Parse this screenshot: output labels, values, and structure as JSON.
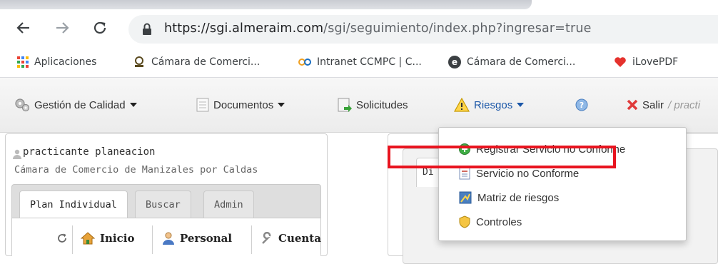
{
  "browser": {
    "url_host": "https://sgi.almeraim.com",
    "url_path": "/sgi/seguimiento/index.php?ingresar=true",
    "nav_icons": [
      "back-arrow-icon",
      "forward-arrow-icon",
      "reload-icon",
      "lock-icon"
    ],
    "bookmarks": [
      {
        "label": "Aplicaciones",
        "icon": "apps-grid-icon"
      },
      {
        "label": "Cámara de Comerci...",
        "icon": "chamber-logo-icon"
      },
      {
        "label": "Intranet CCMPC | C...",
        "icon": "intranet-logo-icon"
      },
      {
        "label": "Cámara de Comerci...",
        "icon": "e-logo-icon"
      },
      {
        "label": "iLovePDF",
        "icon": "heart-icon"
      }
    ]
  },
  "toolbar": {
    "items": [
      {
        "label": "Gestión de Calidad",
        "icon": "gears-icon",
        "has_caret": true
      },
      {
        "label": "Documentos",
        "icon": "document-icon",
        "has_caret": true
      },
      {
        "label": "Solicitudes",
        "icon": "request-icon",
        "has_caret": false
      },
      {
        "label": "Riesgos",
        "icon": "warning-icon",
        "has_caret": true
      },
      {
        "label": "",
        "icon": "help-icon",
        "has_caret": false
      },
      {
        "label": "Salir",
        "icon": "close-x-icon",
        "has_caret": false
      }
    ],
    "user_suffix": "/ practi"
  },
  "riesgos_menu": {
    "items": [
      {
        "label": "Registrar Servicio no Conforme",
        "icon": "add-circle-icon"
      },
      {
        "label": "Servicio no Conforme",
        "icon": "list-document-icon"
      },
      {
        "label": "Matriz de riesgos",
        "icon": "matrix-icon"
      },
      {
        "label": "Controles",
        "icon": "shield-icon"
      }
    ],
    "highlighted_item_index": 0,
    "highlight_color": "#e8141f"
  },
  "user_panel": {
    "name": "practicante planeacion",
    "organization": "Cámara de Comercio de Manizales por Caldas",
    "tabs": [
      {
        "label": "Plan Individual",
        "active": true
      },
      {
        "label": "Buscar",
        "active": false
      },
      {
        "label": "Admin",
        "active": false
      }
    ],
    "inner_items": [
      {
        "label": "",
        "icon": "refresh-icon"
      },
      {
        "label": "Inicio",
        "icon": "home-icon"
      },
      {
        "label": "Personal",
        "icon": "person-icon"
      },
      {
        "label": "Cuenta",
        "icon": "wrench-icon"
      }
    ]
  },
  "right_panel": {
    "tab_label": "Di"
  },
  "colors": {
    "toolbar_bg": "#efefef",
    "accent_blue": "#1b57a8",
    "highlight_red": "#e8141f"
  }
}
